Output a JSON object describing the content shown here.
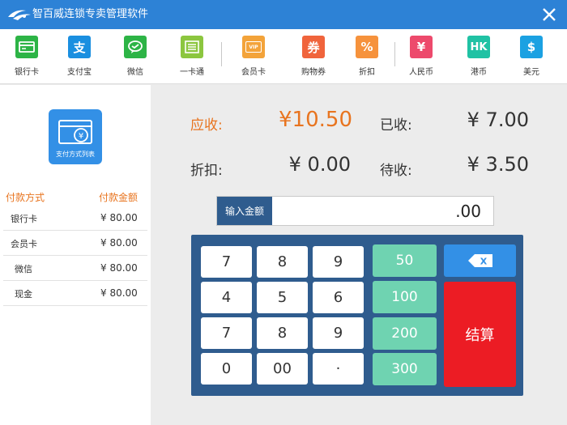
{
  "app": {
    "title": "智百威连锁专卖管理软件"
  },
  "toolbar": {
    "bank_card": "银行卡",
    "alipay": "支付宝",
    "wechat": "微信",
    "one_card": "一卡通",
    "member_card": "会员卡",
    "coupon": "购物券",
    "discount": "折扣",
    "rmb": "人民币",
    "hkd": "港币",
    "usd": "美元"
  },
  "icons": {
    "alipay_glyph": "支",
    "coupon_glyph": "券",
    "member_glyph": "VIP",
    "rmb_glyph": "¥",
    "hkd_glyph": "HK",
    "usd_glyph": "$",
    "discount_glyph": "%",
    "pay_list_glyph": "¥"
  },
  "colors": {
    "title_bar": "#2d82d6",
    "bank_card": "#2db446",
    "alipay": "#1a8fe0",
    "wechat": "#2db446",
    "one_card": "#8cc63f",
    "member_card": "#f3a33a",
    "coupon": "#f0643c",
    "discount": "#f6923c",
    "rmb": "#ed4a6c",
    "hkd": "#20c2a4",
    "usd": "#1ba1e2",
    "accent_orange": "#e8741f",
    "keypad_bg": "#2f5c8e",
    "quick_amount": "#6fd3b1",
    "settle": "#ec1c24"
  },
  "sidebar": {
    "payment_list_label": "支付方式列表",
    "col_method": "付款方式",
    "col_amount": "付款金额",
    "rows": [
      {
        "method": "银行卡",
        "amount": "¥ 80.00"
      },
      {
        "method": "会员卡",
        "amount": "¥ 80.00"
      },
      {
        "method": "微信",
        "amount": "¥ 80.00"
      },
      {
        "method": "现金",
        "amount": "¥ 80.00"
      }
    ]
  },
  "summary": {
    "due_label": "应收:",
    "due_value": "¥10.50",
    "received_label": "已收:",
    "received_value": "¥ 7.00",
    "discount_label": "折扣:",
    "discount_value": "¥ 0.00",
    "pending_label": "待收:",
    "pending_value": "¥ 3.50"
  },
  "amount_input": {
    "label": "输入金额",
    "value": ".00"
  },
  "keypad": {
    "keys": [
      "7",
      "8",
      "9",
      "4",
      "5",
      "6",
      "7",
      "8",
      "9",
      "0",
      "00",
      "·"
    ],
    "quick_amounts": [
      "50",
      "100",
      "200",
      "300"
    ],
    "backspace_glyph": "X",
    "settle_label": "结算"
  }
}
